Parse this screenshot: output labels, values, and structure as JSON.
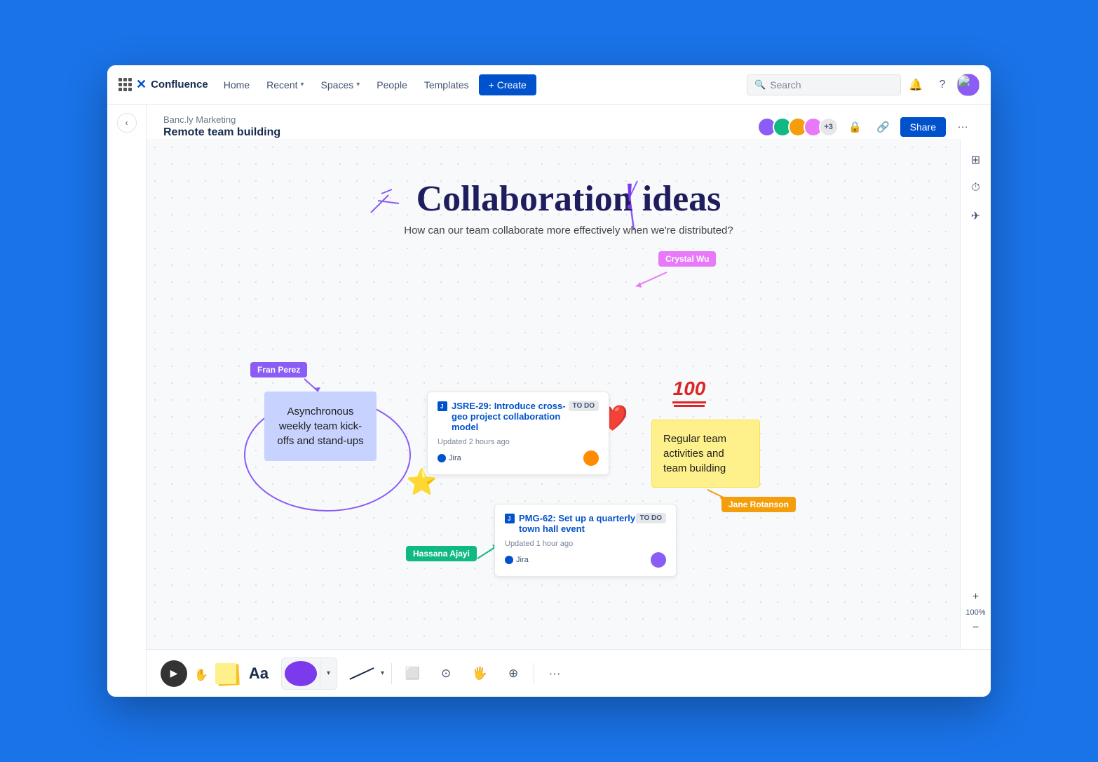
{
  "app": {
    "name": "Confluence",
    "logo_text": "✕"
  },
  "topnav": {
    "home": "Home",
    "recent": "Recent",
    "spaces": "Spaces",
    "people": "People",
    "templates": "Templates",
    "create": "+ Create",
    "search_placeholder": "Search"
  },
  "breadcrumb": {
    "parent": "Banc.ly Marketing",
    "current": "Remote team building"
  },
  "header_actions": {
    "share": "Share",
    "avatar_count": "+3"
  },
  "whiteboard": {
    "title": "Collaboration ideas",
    "subtitle": "How can our team collaborate more effectively when we're distributed?",
    "sticky_note_1": "Asynchronous weekly team kick-offs and stand-ups",
    "sticky_note_2": "Regular team activities and team building",
    "jira_card_1_title": "JSRE-29: Introduce cross-geo project collaboration model",
    "jira_card_1_status": "TO DO",
    "jira_card_1_updated": "Updated 2 hours ago",
    "jira_card_1_source": "Jira",
    "jira_card_2_title": "PMG-62: Set up a quarterly town hall event",
    "jira_card_2_status": "TO DO",
    "jira_card_2_updated": "Updated 1 hour ago",
    "jira_card_2_source": "Jira",
    "user_label_1": "Crystal Wu",
    "user_label_2": "Fran Perez",
    "user_label_3": "Hassana Ajayi",
    "user_label_4": "Jane Rotanson"
  },
  "bottom_toolbar": {
    "text_label": "Aa",
    "zoom_level": "100%"
  },
  "colors": {
    "brand_blue": "#0052cc",
    "user1": "#e879f9",
    "user2": "#8b5cf6",
    "user3": "#10b981",
    "user4": "#f59e0b",
    "sticky_yellow": "#fef08a",
    "sticky_blue": "#c7d2fe"
  }
}
